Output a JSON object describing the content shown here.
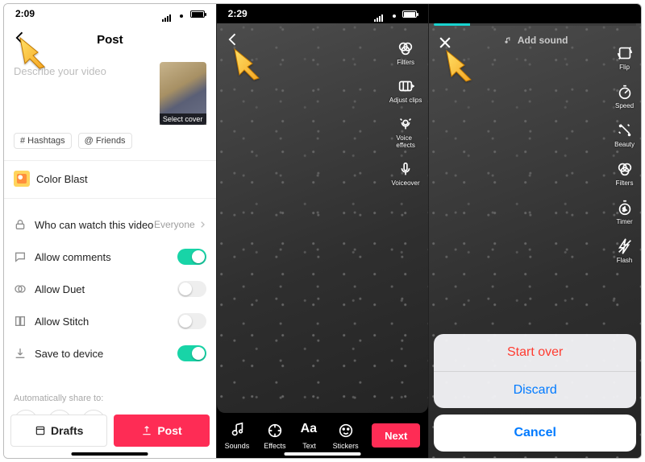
{
  "panel1": {
    "time": "2:09",
    "title": "Post",
    "desc_placeholder": "Describe your video",
    "select_cover": "Select cover",
    "chip_hashtags": "# Hashtags",
    "chip_friends": "@ Friends",
    "effect_name": "Color Blast",
    "privacy_label": "Who can watch this video",
    "privacy_value": "Everyone",
    "comments_label": "Allow comments",
    "duet_label": "Allow Duet",
    "stitch_label": "Allow Stitch",
    "save_label": "Save to device",
    "share_label": "Automatically share to:",
    "drafts_btn": "Drafts",
    "post_btn": "Post"
  },
  "panel2": {
    "time": "2:29",
    "tools_right": [
      {
        "name": "filters",
        "label": "Filters"
      },
      {
        "name": "adjust-clips",
        "label": "Adjust clips"
      },
      {
        "name": "voice-effects",
        "label": "Voice\neffects"
      },
      {
        "name": "voiceover",
        "label": "Voiceover"
      }
    ],
    "tools_bottom": [
      {
        "name": "sounds",
        "label": "Sounds"
      },
      {
        "name": "effects",
        "label": "Effects"
      },
      {
        "name": "text",
        "label": "Text"
      },
      {
        "name": "stickers",
        "label": "Stickers"
      }
    ],
    "next_btn": "Next"
  },
  "panel3": {
    "add_sound": "Add sound",
    "tools_right": [
      {
        "name": "flip",
        "label": "Flip"
      },
      {
        "name": "speed",
        "label": "Speed"
      },
      {
        "name": "beauty",
        "label": "Beauty"
      },
      {
        "name": "filters",
        "label": "Filters"
      },
      {
        "name": "timer",
        "label": "Timer"
      },
      {
        "name": "flash",
        "label": "Flash"
      }
    ],
    "sheet": {
      "start_over": "Start over",
      "discard": "Discard",
      "cancel": "Cancel"
    }
  }
}
